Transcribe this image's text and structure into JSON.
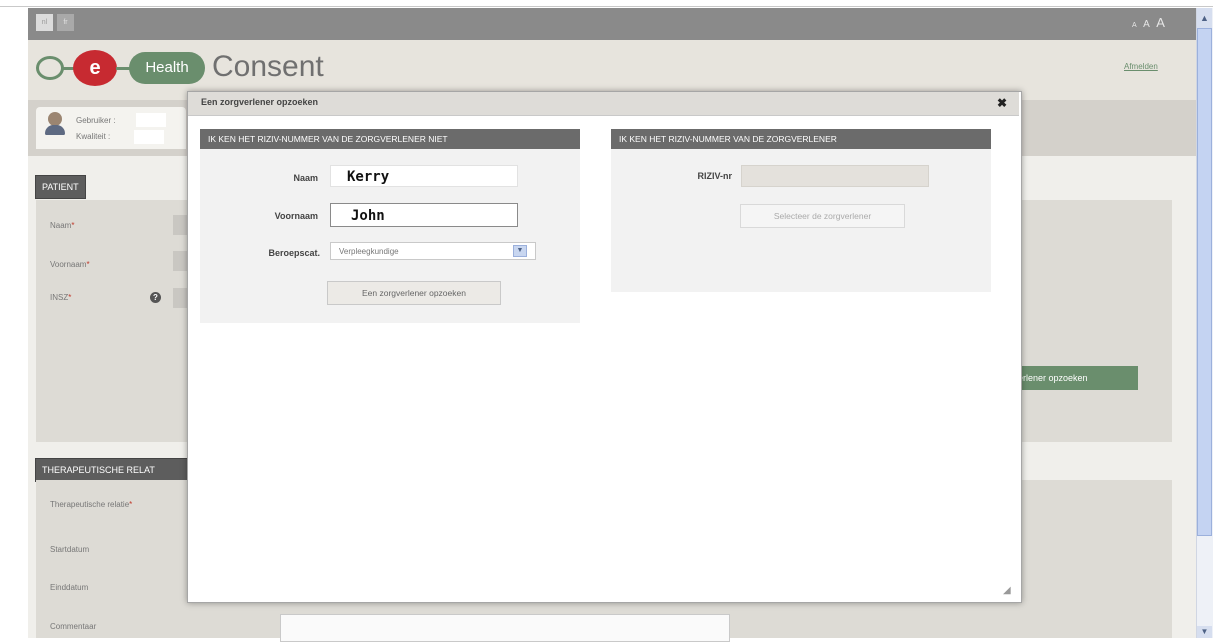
{
  "header": {
    "languages": [
      "nl",
      "fr"
    ],
    "font_size_controls": [
      "A",
      "A",
      "A"
    ],
    "logo": {
      "letter": "e",
      "health": "Health",
      "product": "Consent"
    },
    "logout_label": "Afmelden"
  },
  "userbar": {
    "user_label": "Gebruiker :",
    "quality_label": "Kwaliteit :"
  },
  "patient": {
    "tab_label": "PATIENT",
    "fields": [
      {
        "label": "Naam",
        "required": "*"
      },
      {
        "label": "Voornaam",
        "required": "*"
      },
      {
        "label": "INSZ",
        "required": "*"
      }
    ],
    "help_icon": "?",
    "search_button_label": "erlener opzoeken"
  },
  "therapeutic": {
    "tab_label": "THERAPEUTISCHE RELAT",
    "fields": [
      {
        "label": "Therapeutische relatie",
        "required": "*"
      },
      {
        "label": "Startdatum",
        "required": ""
      },
      {
        "label": "Einddatum",
        "required": ""
      },
      {
        "label": "Commentaar",
        "required": ""
      }
    ]
  },
  "modal": {
    "title": "Een zorgverlener opzoeken",
    "close_icon": "✖",
    "left_section": {
      "title": "IK KEN HET RIZIV-NUMMER VAN DE ZORGVERLENER NIET",
      "naam_label": "Naam",
      "naam_value": "Kerry",
      "voornaam_label": "Voornaam",
      "voornaam_value": "John",
      "beroep_label": "Beroepscat.",
      "beroep_value": "Verpleegkundige",
      "search_button": "Een zorgverlener opzoeken"
    },
    "right_section": {
      "title": "IK KEN HET RIZIV-NUMMER VAN DE ZORGVERLENER",
      "riziv_label": "RIZIV-nr",
      "riziv_value": "",
      "select_button": "Selecteer de zorgverlener"
    }
  },
  "colors": {
    "accent_green": "#6a8e6d",
    "logo_red": "#c72a31",
    "section_header": "#6b6b6b",
    "required": "#c0392b"
  }
}
